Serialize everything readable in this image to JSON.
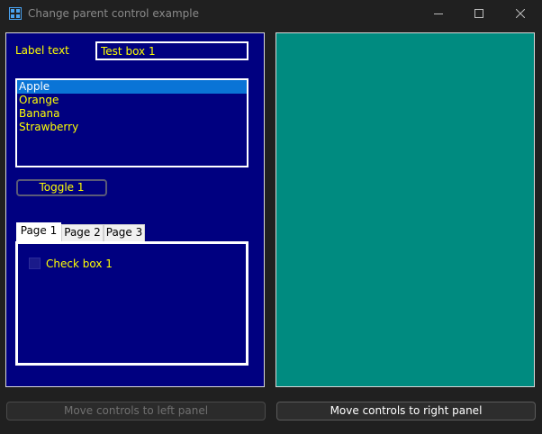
{
  "window": {
    "title": "Change parent control example",
    "icon": "app-window-icon",
    "controls": [
      "minimize-icon",
      "maximize-icon",
      "close-icon"
    ]
  },
  "left_panel": {
    "label_text": "Label text",
    "textbox_value": "Test box 1",
    "listbox": {
      "items": [
        "Apple",
        "Orange",
        "Banana",
        "Strawberry"
      ],
      "selected": "Apple"
    },
    "toggle_label": "Toggle 1",
    "tabs": [
      "Page 1",
      "Page 2",
      "Page 3"
    ],
    "active_tab": "Page 1",
    "checkbox_label": "Check box 1",
    "checkbox_checked": false
  },
  "colors": {
    "window_bg": "#202020",
    "left_panel_bg": "#000080",
    "right_panel_bg": "#008b80",
    "text_yellow": "#ffff00",
    "selection": "#0a74d6"
  },
  "footer": {
    "move_left_label": "Move controls to left panel",
    "move_left_enabled": false,
    "move_right_label": "Move controls to right panel",
    "move_right_enabled": true
  }
}
